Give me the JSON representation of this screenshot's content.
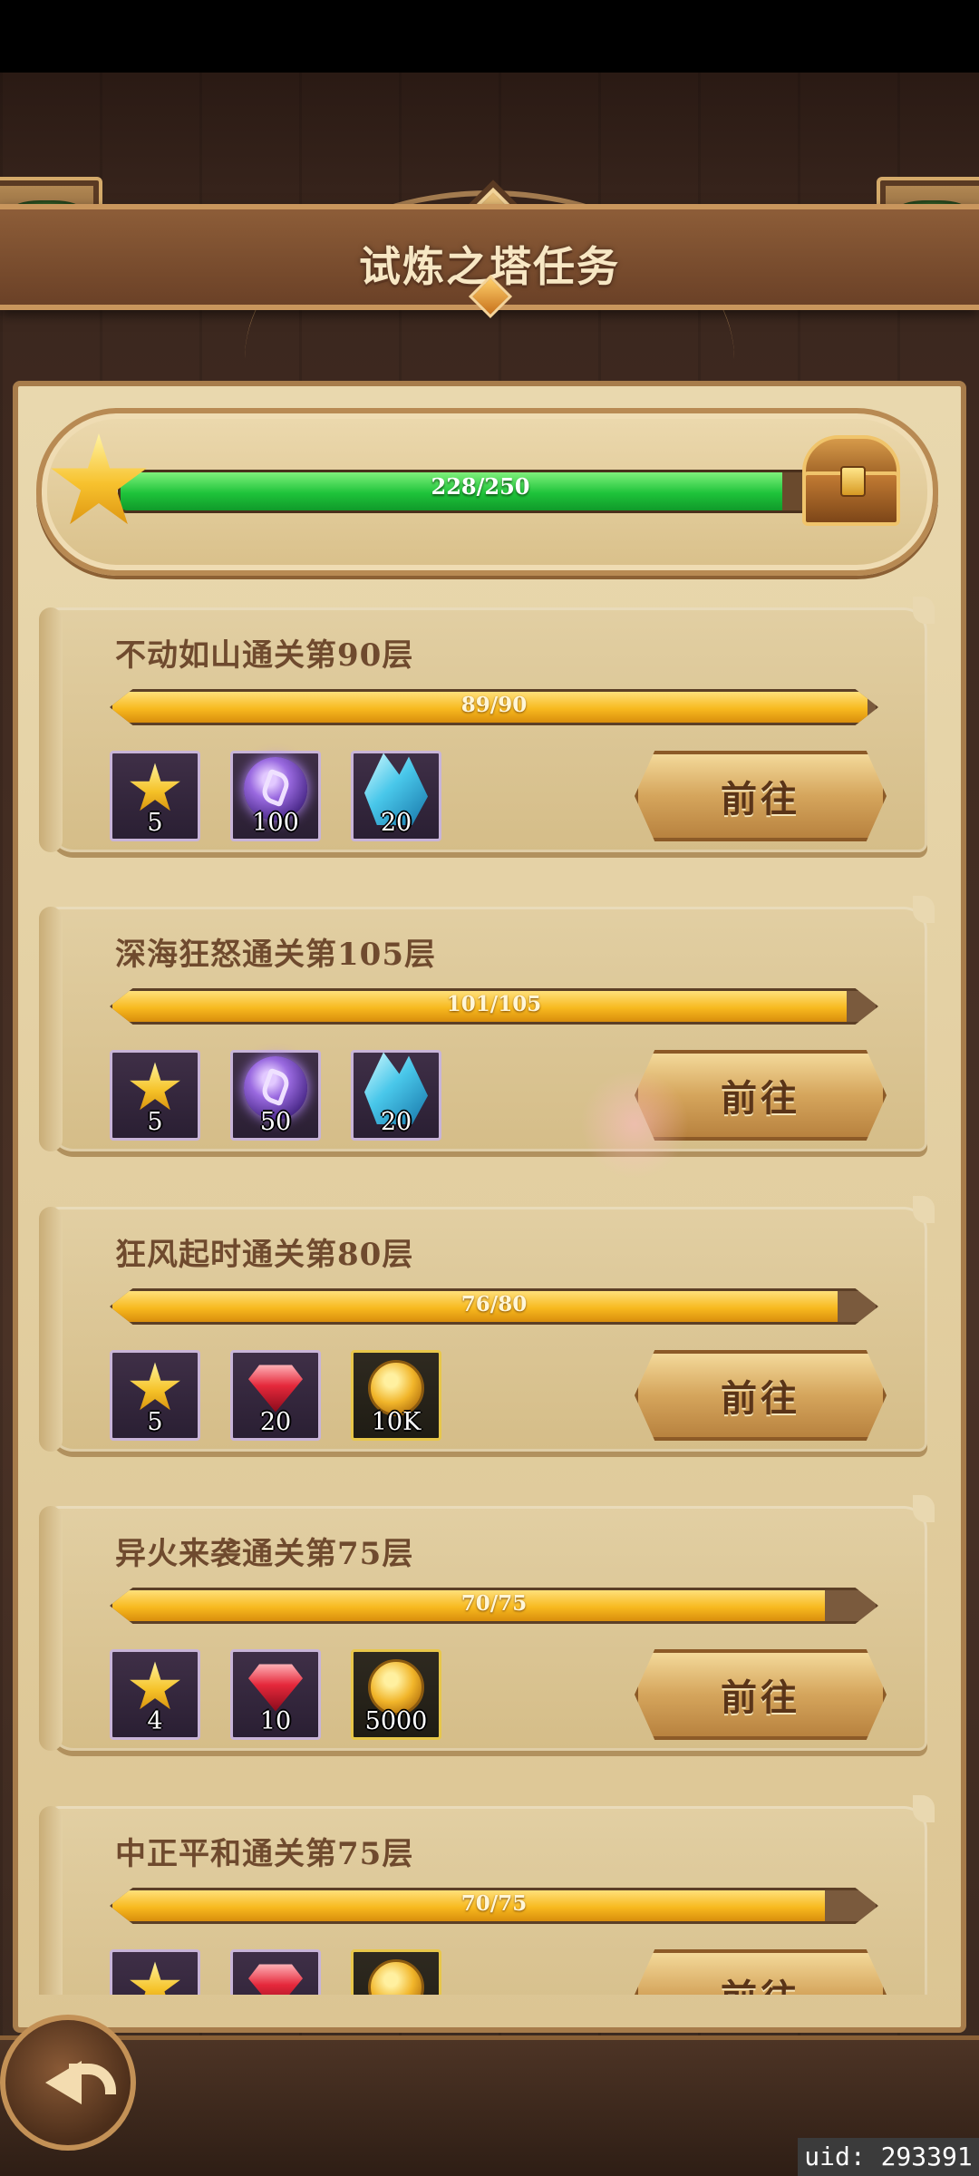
{
  "header": {
    "title": "试炼之塔任务"
  },
  "total_progress": {
    "text": "228/250",
    "fraction": 0.912
  },
  "tasks": [
    {
      "title": "不动如山通关第90层",
      "progress_text": "89/90",
      "fraction": 0.989,
      "rewards": [
        {
          "icon": "star-icon",
          "count": "5"
        },
        {
          "icon": "purple-orb-icon",
          "count": "100"
        },
        {
          "icon": "blue-crystal-icon",
          "count": "20"
        }
      ],
      "button": "前往"
    },
    {
      "title": "深海狂怒通关第105层",
      "progress_text": "101/105",
      "fraction": 0.962,
      "rewards": [
        {
          "icon": "star-icon",
          "count": "5"
        },
        {
          "icon": "purple-orb-icon",
          "count": "50"
        },
        {
          "icon": "blue-crystal-icon",
          "count": "20"
        }
      ],
      "button": "前往"
    },
    {
      "title": "狂风起时通关第80层",
      "progress_text": "76/80",
      "fraction": 0.95,
      "rewards": [
        {
          "icon": "star-icon",
          "count": "5"
        },
        {
          "icon": "ruby-icon",
          "count": "20"
        },
        {
          "icon": "gold-coin-icon",
          "count": "10K"
        }
      ],
      "button": "前往"
    },
    {
      "title": "异火来袭通关第75层",
      "progress_text": "70/75",
      "fraction": 0.933,
      "rewards": [
        {
          "icon": "star-icon",
          "count": "4"
        },
        {
          "icon": "ruby-icon",
          "count": "10"
        },
        {
          "icon": "gold-coin-icon",
          "count": "5000"
        }
      ],
      "button": "前往"
    },
    {
      "title": "中正平和通关第75层",
      "progress_text": "70/75",
      "fraction": 0.933,
      "rewards": [
        {
          "icon": "star-icon",
          "count": ""
        },
        {
          "icon": "ruby-icon",
          "count": ""
        },
        {
          "icon": "gold-coin-icon",
          "count": ""
        }
      ],
      "button": "前往"
    }
  ],
  "footer": {
    "uid_text": "uid: 293391",
    "back_icon": "back-arrow-icon"
  },
  "colors": {
    "green_fill": "#1ec33a",
    "gold_fill": "#f7b91f",
    "frame": "#a77c4b"
  }
}
